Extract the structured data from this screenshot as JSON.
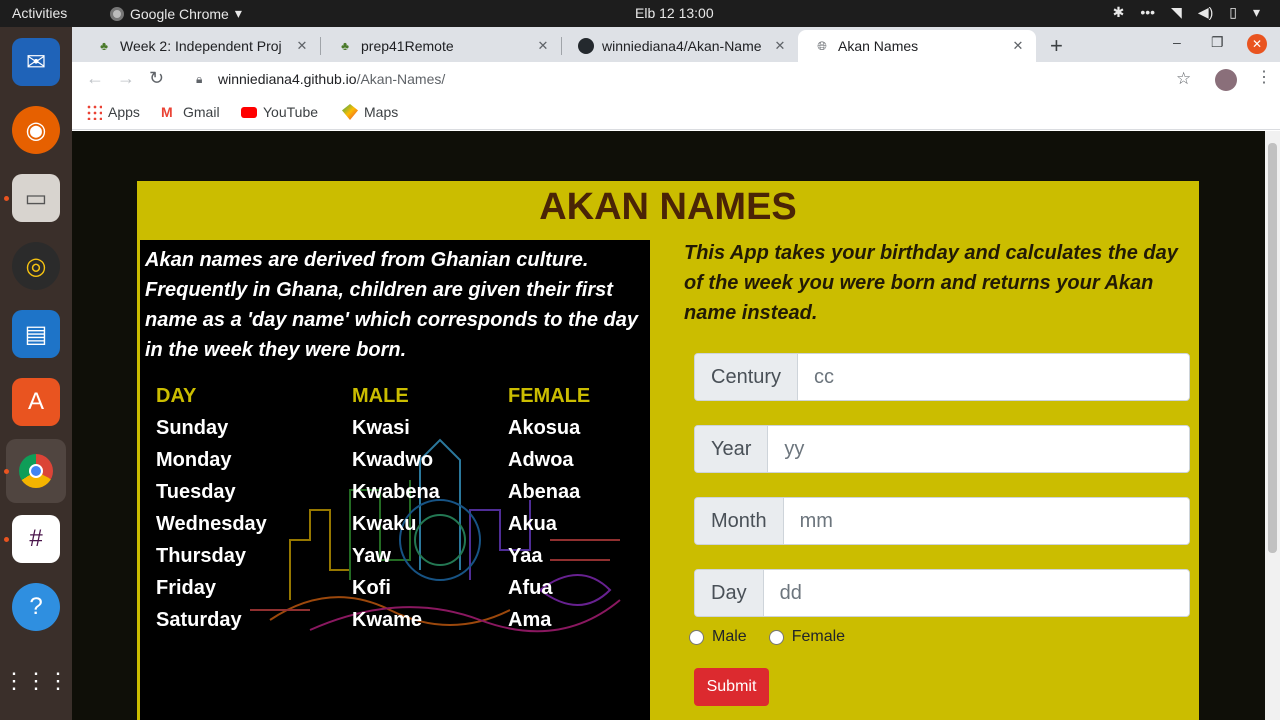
{
  "system": {
    "activities": "Activities",
    "app_name": "Google Chrome",
    "clock": "Elb 12  13:00"
  },
  "dock": {
    "apps": [
      "thunderbird-icon",
      "firefox-icon",
      "files-icon",
      "rhythmbox-icon",
      "writer-icon",
      "software-icon",
      "chrome-icon",
      "slack-icon",
      "help-icon",
      "app-grid-icon"
    ]
  },
  "browser": {
    "tabs": [
      {
        "title": "Week 2: Independent Proj",
        "active": false
      },
      {
        "title": "prep41Remote",
        "active": false
      },
      {
        "title": "winniediana4/Akan-Name",
        "active": false
      },
      {
        "title": "Akan Names",
        "active": true
      }
    ],
    "url_host": "winniediana4.github.io",
    "url_path": "/Akan-Names/",
    "bookmarks": [
      "Apps",
      "Gmail",
      "YouTube",
      "Maps"
    ]
  },
  "page": {
    "title": "AKAN NAMES",
    "intro": "Akan names are derived from Ghanian culture. Frequently in Ghana, children are given their first name as a 'day name' which corresponds to the day in the week they were born.",
    "description": "This App takes your birthday and calculates the day of the week you were born and returns your Akan name instead.",
    "table": {
      "headers": [
        "DAY",
        "MALE",
        "FEMALE"
      ],
      "rows": [
        [
          "Sunday",
          "Kwasi",
          "Akosua"
        ],
        [
          "Monday",
          "Kwadwo",
          "Adwoa"
        ],
        [
          "Tuesday",
          "Kwabena",
          "Abenaa"
        ],
        [
          "Wednesday",
          "Kwaku",
          "Akua"
        ],
        [
          "Thursday",
          "Yaw",
          "Yaa"
        ],
        [
          "Friday",
          "Kofi",
          "Afua"
        ],
        [
          "Saturday",
          "Kwame",
          "Ama"
        ]
      ]
    },
    "form": {
      "century_label": "Century",
      "century_placeholder": "cc",
      "year_label": "Year",
      "year_placeholder": "yy",
      "month_label": "Month",
      "month_placeholder": "mm",
      "day_label": "Day",
      "day_placeholder": "dd",
      "male_label": "Male",
      "female_label": "Female",
      "submit_label": "Submit"
    }
  }
}
